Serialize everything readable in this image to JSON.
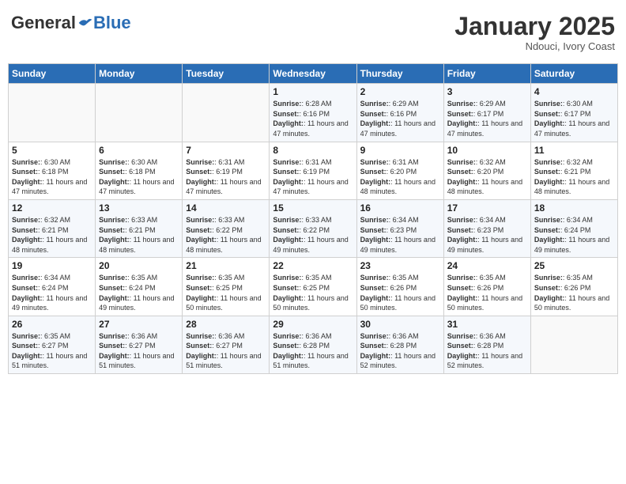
{
  "header": {
    "logo_general": "General",
    "logo_blue": "Blue",
    "month": "January 2025",
    "location": "Ndouci, Ivory Coast"
  },
  "weekdays": [
    "Sunday",
    "Monday",
    "Tuesday",
    "Wednesday",
    "Thursday",
    "Friday",
    "Saturday"
  ],
  "weeks": [
    [
      {
        "day": "",
        "info": ""
      },
      {
        "day": "",
        "info": ""
      },
      {
        "day": "",
        "info": ""
      },
      {
        "day": "1",
        "info": "Sunrise: 6:28 AM\nSunset: 6:16 PM\nDaylight: 11 hours and 47 minutes."
      },
      {
        "day": "2",
        "info": "Sunrise: 6:29 AM\nSunset: 6:16 PM\nDaylight: 11 hours and 47 minutes."
      },
      {
        "day": "3",
        "info": "Sunrise: 6:29 AM\nSunset: 6:17 PM\nDaylight: 11 hours and 47 minutes."
      },
      {
        "day": "4",
        "info": "Sunrise: 6:30 AM\nSunset: 6:17 PM\nDaylight: 11 hours and 47 minutes."
      }
    ],
    [
      {
        "day": "5",
        "info": "Sunrise: 6:30 AM\nSunset: 6:18 PM\nDaylight: 11 hours and 47 minutes."
      },
      {
        "day": "6",
        "info": "Sunrise: 6:30 AM\nSunset: 6:18 PM\nDaylight: 11 hours and 47 minutes."
      },
      {
        "day": "7",
        "info": "Sunrise: 6:31 AM\nSunset: 6:19 PM\nDaylight: 11 hours and 47 minutes."
      },
      {
        "day": "8",
        "info": "Sunrise: 6:31 AM\nSunset: 6:19 PM\nDaylight: 11 hours and 47 minutes."
      },
      {
        "day": "9",
        "info": "Sunrise: 6:31 AM\nSunset: 6:20 PM\nDaylight: 11 hours and 48 minutes."
      },
      {
        "day": "10",
        "info": "Sunrise: 6:32 AM\nSunset: 6:20 PM\nDaylight: 11 hours and 48 minutes."
      },
      {
        "day": "11",
        "info": "Sunrise: 6:32 AM\nSunset: 6:21 PM\nDaylight: 11 hours and 48 minutes."
      }
    ],
    [
      {
        "day": "12",
        "info": "Sunrise: 6:32 AM\nSunset: 6:21 PM\nDaylight: 11 hours and 48 minutes."
      },
      {
        "day": "13",
        "info": "Sunrise: 6:33 AM\nSunset: 6:21 PM\nDaylight: 11 hours and 48 minutes."
      },
      {
        "day": "14",
        "info": "Sunrise: 6:33 AM\nSunset: 6:22 PM\nDaylight: 11 hours and 48 minutes."
      },
      {
        "day": "15",
        "info": "Sunrise: 6:33 AM\nSunset: 6:22 PM\nDaylight: 11 hours and 49 minutes."
      },
      {
        "day": "16",
        "info": "Sunrise: 6:34 AM\nSunset: 6:23 PM\nDaylight: 11 hours and 49 minutes."
      },
      {
        "day": "17",
        "info": "Sunrise: 6:34 AM\nSunset: 6:23 PM\nDaylight: 11 hours and 49 minutes."
      },
      {
        "day": "18",
        "info": "Sunrise: 6:34 AM\nSunset: 6:24 PM\nDaylight: 11 hours and 49 minutes."
      }
    ],
    [
      {
        "day": "19",
        "info": "Sunrise: 6:34 AM\nSunset: 6:24 PM\nDaylight: 11 hours and 49 minutes."
      },
      {
        "day": "20",
        "info": "Sunrise: 6:35 AM\nSunset: 6:24 PM\nDaylight: 11 hours and 49 minutes."
      },
      {
        "day": "21",
        "info": "Sunrise: 6:35 AM\nSunset: 6:25 PM\nDaylight: 11 hours and 50 minutes."
      },
      {
        "day": "22",
        "info": "Sunrise: 6:35 AM\nSunset: 6:25 PM\nDaylight: 11 hours and 50 minutes."
      },
      {
        "day": "23",
        "info": "Sunrise: 6:35 AM\nSunset: 6:26 PM\nDaylight: 11 hours and 50 minutes."
      },
      {
        "day": "24",
        "info": "Sunrise: 6:35 AM\nSunset: 6:26 PM\nDaylight: 11 hours and 50 minutes."
      },
      {
        "day": "25",
        "info": "Sunrise: 6:35 AM\nSunset: 6:26 PM\nDaylight: 11 hours and 50 minutes."
      }
    ],
    [
      {
        "day": "26",
        "info": "Sunrise: 6:35 AM\nSunset: 6:27 PM\nDaylight: 11 hours and 51 minutes."
      },
      {
        "day": "27",
        "info": "Sunrise: 6:36 AM\nSunset: 6:27 PM\nDaylight: 11 hours and 51 minutes."
      },
      {
        "day": "28",
        "info": "Sunrise: 6:36 AM\nSunset: 6:27 PM\nDaylight: 11 hours and 51 minutes."
      },
      {
        "day": "29",
        "info": "Sunrise: 6:36 AM\nSunset: 6:28 PM\nDaylight: 11 hours and 51 minutes."
      },
      {
        "day": "30",
        "info": "Sunrise: 6:36 AM\nSunset: 6:28 PM\nDaylight: 11 hours and 52 minutes."
      },
      {
        "day": "31",
        "info": "Sunrise: 6:36 AM\nSunset: 6:28 PM\nDaylight: 11 hours and 52 minutes."
      },
      {
        "day": "",
        "info": ""
      }
    ]
  ]
}
